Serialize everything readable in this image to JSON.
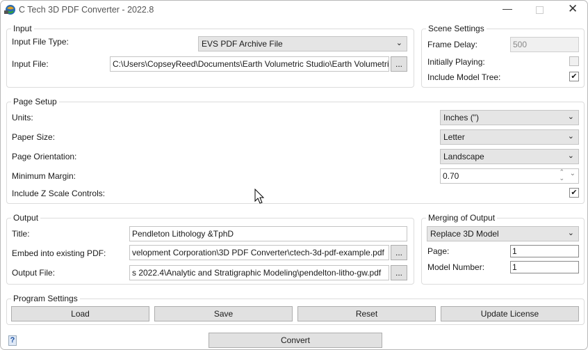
{
  "window": {
    "title": "C Tech 3D PDF Converter - 2022.8",
    "icon": "app-globe-icon"
  },
  "input": {
    "legend": "Input",
    "file_type_label": "Input File Type:",
    "file_type_value": "EVS PDF Archive File",
    "file_label": "Input File:",
    "file_value": "C:\\Users\\CopseyReed\\Documents\\Earth Volumetric Studio\\Earth Volumetric",
    "browse": "..."
  },
  "scene": {
    "legend": "Scene Settings",
    "frame_delay_label": "Frame Delay:",
    "frame_delay_value": "500",
    "initially_playing_label": "Initially Playing:",
    "initially_playing": false,
    "model_tree_label": "Include Model Tree:",
    "model_tree": true
  },
  "page_setup": {
    "legend": "Page Setup",
    "units_label": "Units:",
    "units_value": "Inches (\")",
    "paper_label": "Paper Size:",
    "paper_value": "Letter",
    "orientation_label": "Page Orientation:",
    "orientation_value": "Landscape",
    "margin_label": "Minimum Margin:",
    "margin_value": "0.70",
    "zscale_label": "Include Z Scale Controls:",
    "zscale": true
  },
  "output": {
    "legend": "Output",
    "title_label": "Title:",
    "title_value": "Pendleton Lithology &TphD",
    "embed_label": "Embed into existing PDF:",
    "embed_value": "velopment Corporation\\3D PDF Converter\\ctech-3d-pdf-example.pdf",
    "file_label": "Output File:",
    "file_value": "s 2022.4\\Analytic and Stratigraphic Modeling\\pendelton-litho-gw.pdf",
    "browse": "..."
  },
  "merging": {
    "legend": "Merging of Output",
    "mode_value": "Replace 3D Model",
    "page_label": "Page:",
    "page_value": "1",
    "model_label": "Model Number:",
    "model_value": "1"
  },
  "program": {
    "legend": "Program Settings",
    "load": "Load",
    "save": "Save",
    "reset": "Reset",
    "update": "Update License"
  },
  "footer": {
    "help": "?",
    "convert": "Convert"
  }
}
